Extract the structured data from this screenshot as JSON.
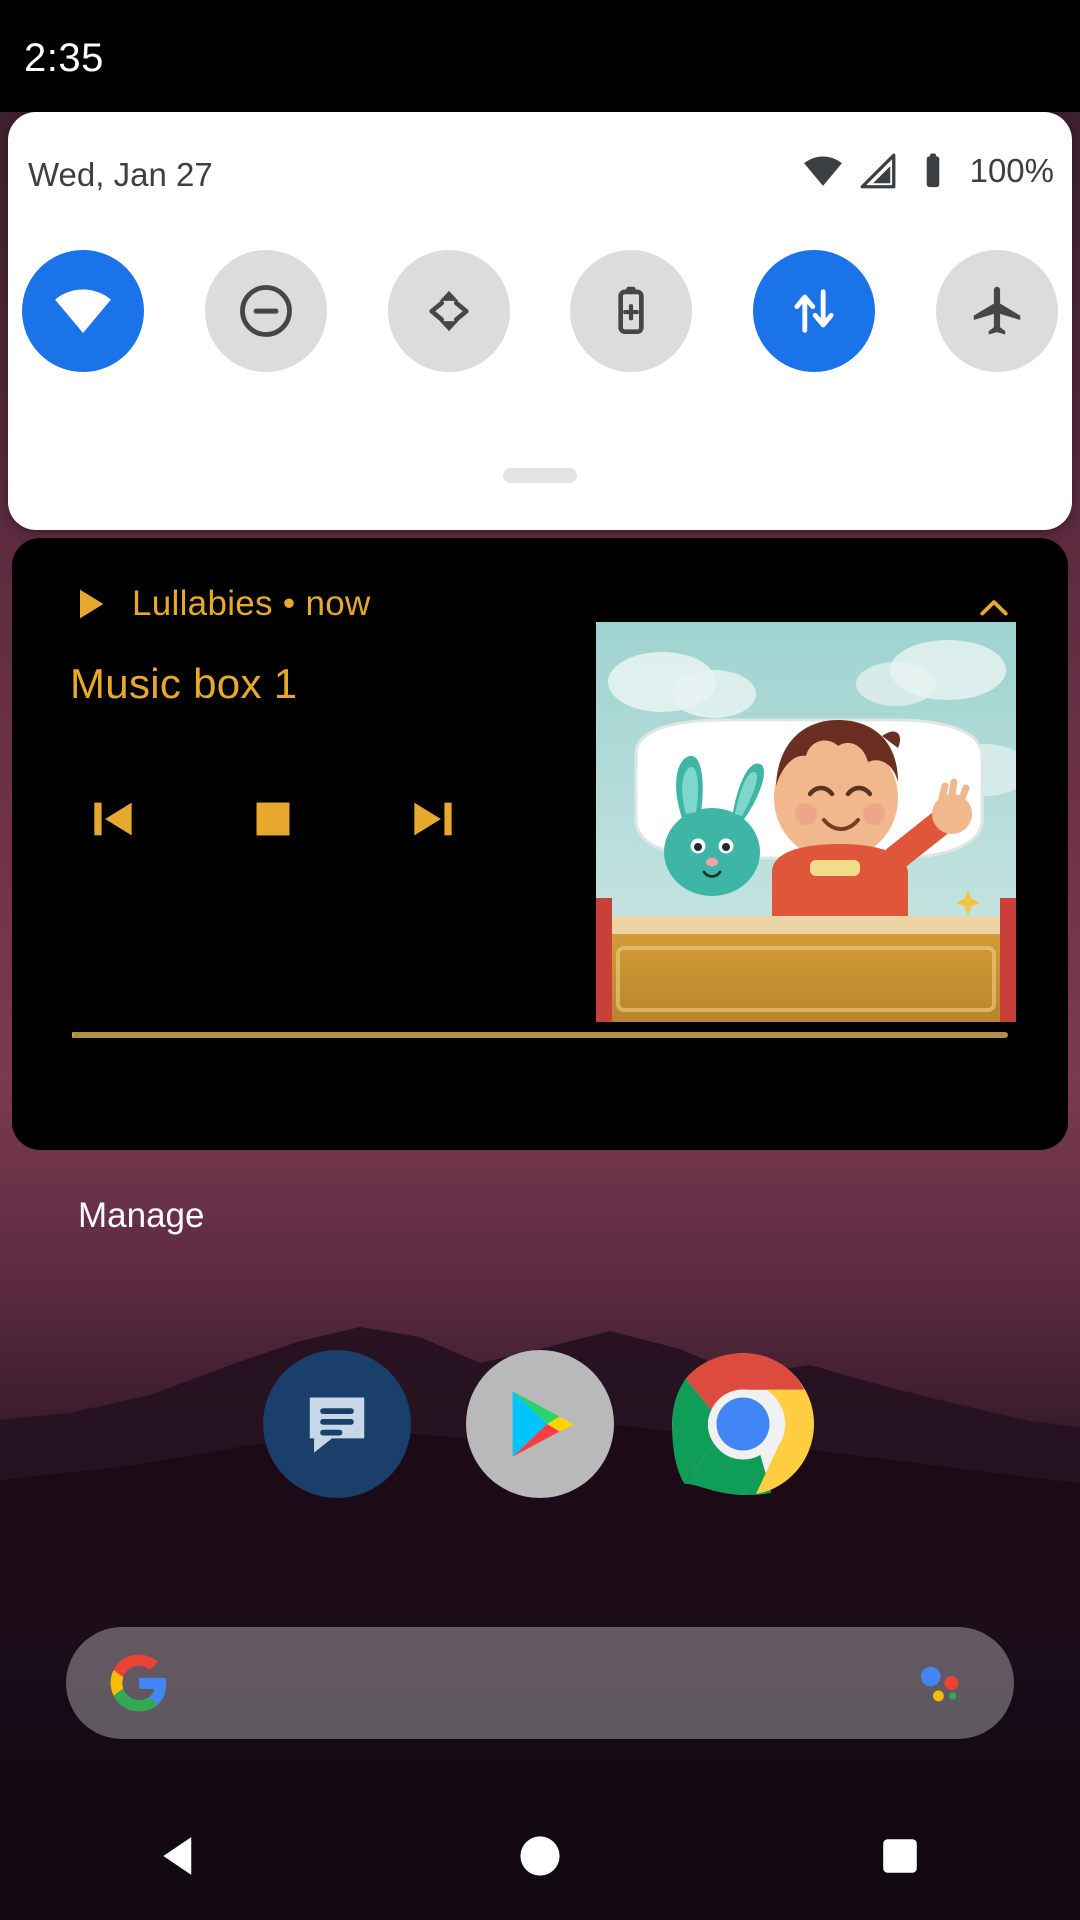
{
  "status_bar": {
    "time": "2:35"
  },
  "quick_settings": {
    "date": "Wed, Jan 27",
    "battery_percent": "100%",
    "status_icons": [
      "wifi-icon",
      "cell-signal-icon",
      "battery-icon"
    ],
    "accent_active": "#1a73e8",
    "tile_inactive_bg": "#dcdcdc",
    "tiles": [
      {
        "name": "internet",
        "icon": "wifi-icon",
        "state": "on",
        "label": "Internet"
      },
      {
        "name": "do-not-disturb",
        "icon": "dnd-icon",
        "state": "off",
        "label": "Do Not Disturb"
      },
      {
        "name": "auto-rotate",
        "icon": "auto-rotate-icon",
        "state": "off",
        "label": "Auto-rotate"
      },
      {
        "name": "battery-saver",
        "icon": "battery-saver-icon",
        "state": "off",
        "label": "Battery Saver"
      },
      {
        "name": "mobile-data",
        "icon": "mobile-data-icon",
        "state": "on",
        "label": "Mobile data"
      },
      {
        "name": "airplane-mode",
        "icon": "airplane-icon",
        "state": "off",
        "label": "Airplane mode"
      }
    ]
  },
  "media_notification": {
    "app_name": "Lullabies",
    "separator": "•",
    "time": "now",
    "header_text": "Lullabies • now",
    "track_title": "Music box 1",
    "accent_color": "#e6a92e",
    "background_color": "#000000",
    "collapse_icon": "chevron-up-icon",
    "play_state_icon": "play-icon",
    "controls": [
      {
        "name": "previous",
        "icon": "skip-previous-icon"
      },
      {
        "name": "stop",
        "icon": "stop-icon"
      },
      {
        "name": "next",
        "icon": "skip-next-icon"
      }
    ],
    "progress_percent": 0,
    "album_art_alt": "Sleeping child with teal bunny plush in bed"
  },
  "notifications": {
    "manage_label": "Manage"
  },
  "home_screen": {
    "apps": [
      {
        "name": "messages",
        "label": "Messages"
      },
      {
        "name": "play-store",
        "label": "Play Store"
      },
      {
        "name": "chrome",
        "label": "Chrome"
      }
    ],
    "search": {
      "placeholder": "",
      "value": "",
      "left_icon": "google-g-icon",
      "right_icon": "google-assistant-icon"
    }
  },
  "nav_bar": {
    "buttons": [
      {
        "name": "back",
        "icon": "back-triangle-icon"
      },
      {
        "name": "home",
        "icon": "home-circle-icon"
      },
      {
        "name": "recents",
        "icon": "recents-square-icon"
      }
    ]
  }
}
